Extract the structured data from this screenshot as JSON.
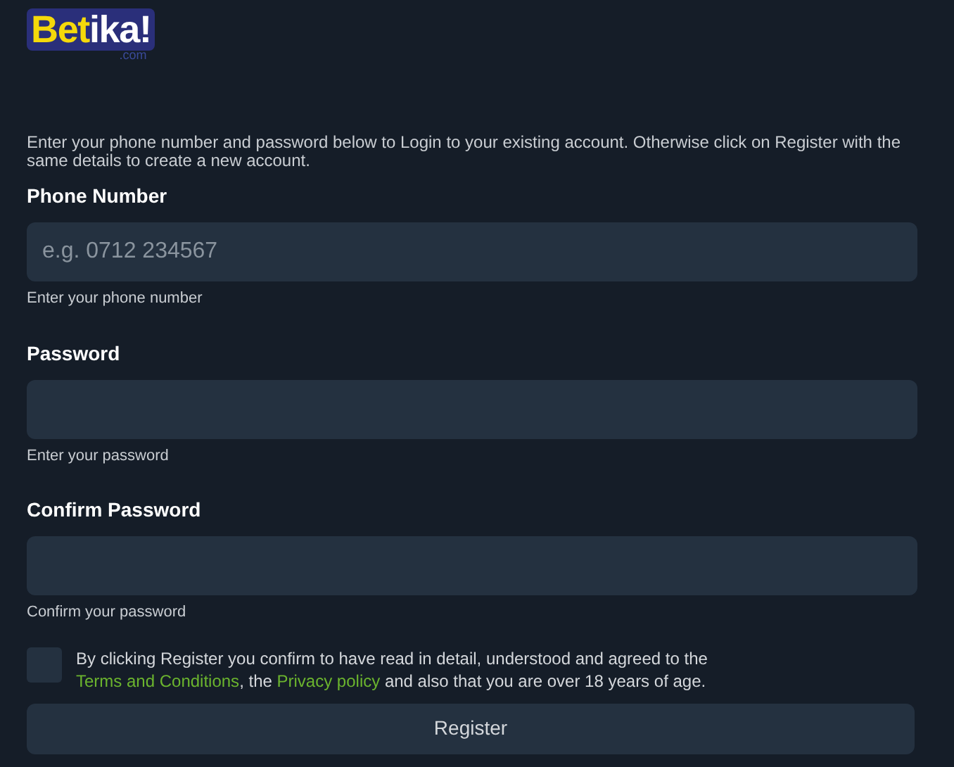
{
  "logo": {
    "first": "Bet",
    "second": "ika!",
    "domain": ".com"
  },
  "intro": "Enter your phone number and password below to Login to your existing account. Otherwise click on Register with the same details to create a new account.",
  "fields": [
    {
      "label": "Phone Number",
      "placeholder": "e.g. 0712 234567",
      "hint": "Enter your phone number"
    },
    {
      "label": "Password",
      "hint": "Enter your password"
    },
    {
      "label": "Confirm Password",
      "hint": "Confirm your password"
    }
  ],
  "consent": {
    "checked": false,
    "parts": [
      {
        "kind": "text",
        "text": "By clicking Register you confirm to have read in detail, understood and agreed to the "
      },
      {
        "kind": "link",
        "text": "Terms and Conditions"
      },
      {
        "kind": "text",
        "text": ", the "
      },
      {
        "kind": "link",
        "text": "Privacy policy"
      },
      {
        "kind": "text",
        "text": " and also that you are over 18 years of age."
      }
    ]
  },
  "submit": "Register"
}
